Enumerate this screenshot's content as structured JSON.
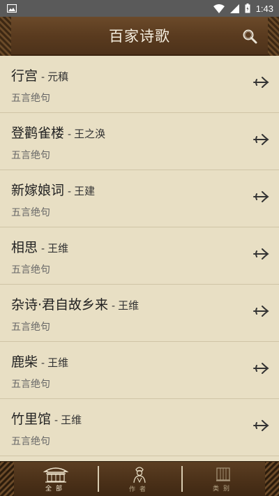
{
  "status_bar": {
    "time": "1:43",
    "icons": [
      "image-icon",
      "wifi-icon",
      "signal-icon",
      "battery-icon"
    ]
  },
  "header": {
    "title": "百家诗歌",
    "search_icon": "search-icon"
  },
  "poems": [
    {
      "title": "行宫",
      "sep": "-",
      "author": "元稹",
      "genre": "五言绝句"
    },
    {
      "title": "登鹳雀楼",
      "sep": "-",
      "author": "王之涣",
      "genre": "五言绝句"
    },
    {
      "title": "新嫁娘词",
      "sep": "-",
      "author": "王建",
      "genre": "五言绝句"
    },
    {
      "title": "相思",
      "sep": "-",
      "author": "王维",
      "genre": "五言绝句"
    },
    {
      "title": "杂诗·君自故乡来",
      "sep": "-",
      "author": "王维",
      "genre": "五言绝句"
    },
    {
      "title": "鹿柴",
      "sep": "-",
      "author": "王维",
      "genre": "五言绝句"
    },
    {
      "title": "竹里馆",
      "sep": "-",
      "author": "王维",
      "genre": "五言绝句"
    }
  ],
  "bottom_nav": {
    "tabs": [
      {
        "label": "全部",
        "icon": "pavilion-icon",
        "active": true
      },
      {
        "label": "作者",
        "icon": "scholar-icon",
        "active": false
      },
      {
        "label": "类别",
        "icon": "scroll-icon",
        "active": false
      }
    ]
  },
  "colors": {
    "background": "#e8dfc4",
    "header_wood": "#5a3b1f",
    "title_text": "#f5efe0",
    "divider": "#cfc4a6"
  }
}
